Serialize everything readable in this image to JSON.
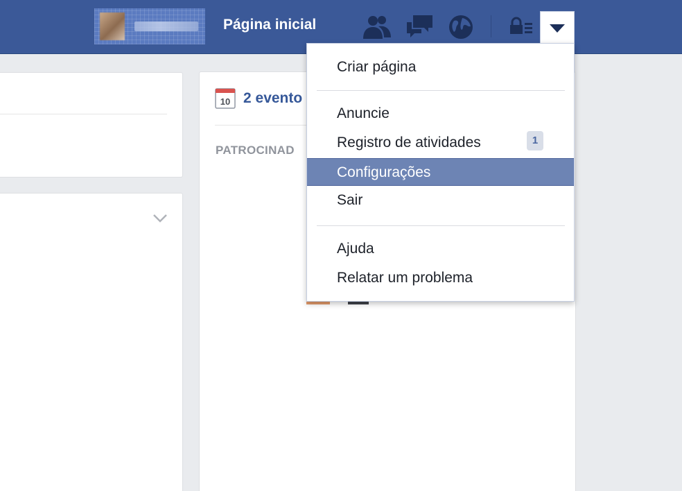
{
  "topbar": {
    "home_label": "Página inicial",
    "background_color": "#3b5998",
    "icons": [
      "friend-requests-icon",
      "messages-icon",
      "notifications-globe-icon",
      "privacy-shortcuts-icon",
      "account-menu-chevron-icon"
    ]
  },
  "main": {
    "calendar_day": "10",
    "events_label": "2 evento",
    "sponsored_label": "PATROCINAD"
  },
  "menu": {
    "items": [
      {
        "label": "Criar página"
      },
      {
        "label": "Anuncie"
      },
      {
        "label": "Registro de atividades",
        "badge": "1"
      },
      {
        "label": "Configurações",
        "selected": true
      },
      {
        "label": "Sair"
      },
      {
        "label": "Ajuda"
      },
      {
        "label": "Relatar um problema"
      }
    ],
    "selected_color": "#6d84b4"
  }
}
